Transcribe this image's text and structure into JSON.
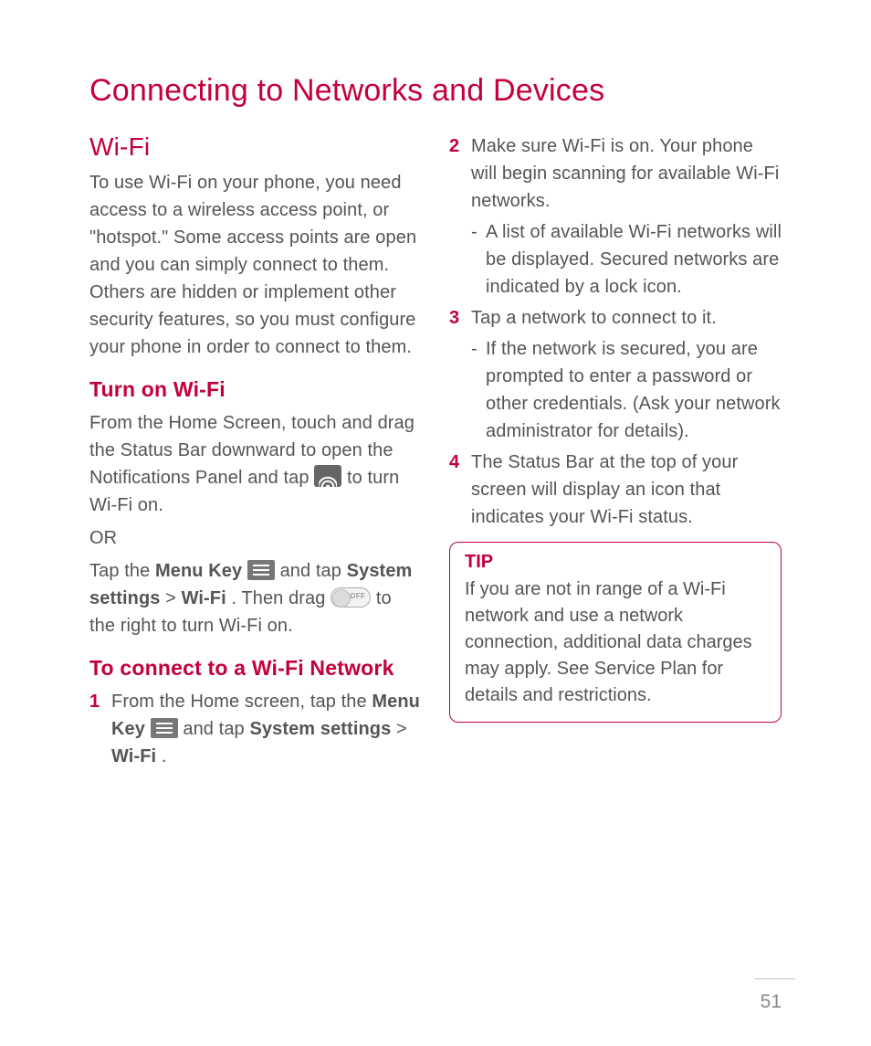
{
  "page_number": "51",
  "title": "Connecting to Networks and Devices",
  "section_wifi": "Wi-Fi",
  "wifi_intro": "To use Wi-Fi on your phone, you need access to a wireless access point, or \"hotspot.\" Some access points are open and you can simply connect to them. Others are hidden or implement other security features, so you must configure your phone in order to connect to them.",
  "h_turn_on": "Turn on Wi-Fi",
  "turn_on_a1": "From the Home Screen, touch and drag the Status Bar downward to open the Notifications Panel and tap ",
  "turn_on_a2": " to turn Wi-Fi on.",
  "or": "OR",
  "turn_on_b1": "Tap the ",
  "menu_key": "Menu Key",
  "turn_on_b2": " and tap ",
  "system_settings": "System settings",
  "gt": " > ",
  "wifi_bold": "Wi-Fi",
  "turn_on_b3": ". Then drag ",
  "turn_on_b4": " to the right to turn Wi-Fi on.",
  "h_connect": "To connect to a Wi-Fi Network",
  "s1_num": "1",
  "s1a": "From the Home screen, tap the ",
  "s1b": " and tap ",
  "s1c": ".",
  "s2_num": "2",
  "s2": "Make sure Wi-Fi is on. Your phone will begin scanning for available Wi-Fi networks.",
  "s2_sub": "A list of available Wi-Fi networks will be displayed. Secured networks are indicated by a lock icon.",
  "s3_num": "3",
  "s3": "Tap a network to connect to it.",
  "s3_sub": "If the network is secured, you are prompted to enter a password or other credentials. (Ask your network administrator for details).",
  "s4_num": "4",
  "s4": "The Status Bar at the top of your screen will display an icon that indicates your Wi-Fi status.",
  "tip_label": "TIP",
  "tip_body": "If you are not in range of a Wi-Fi network and use a network connection, additional data charges may apply. See Service Plan for details and restrictions."
}
